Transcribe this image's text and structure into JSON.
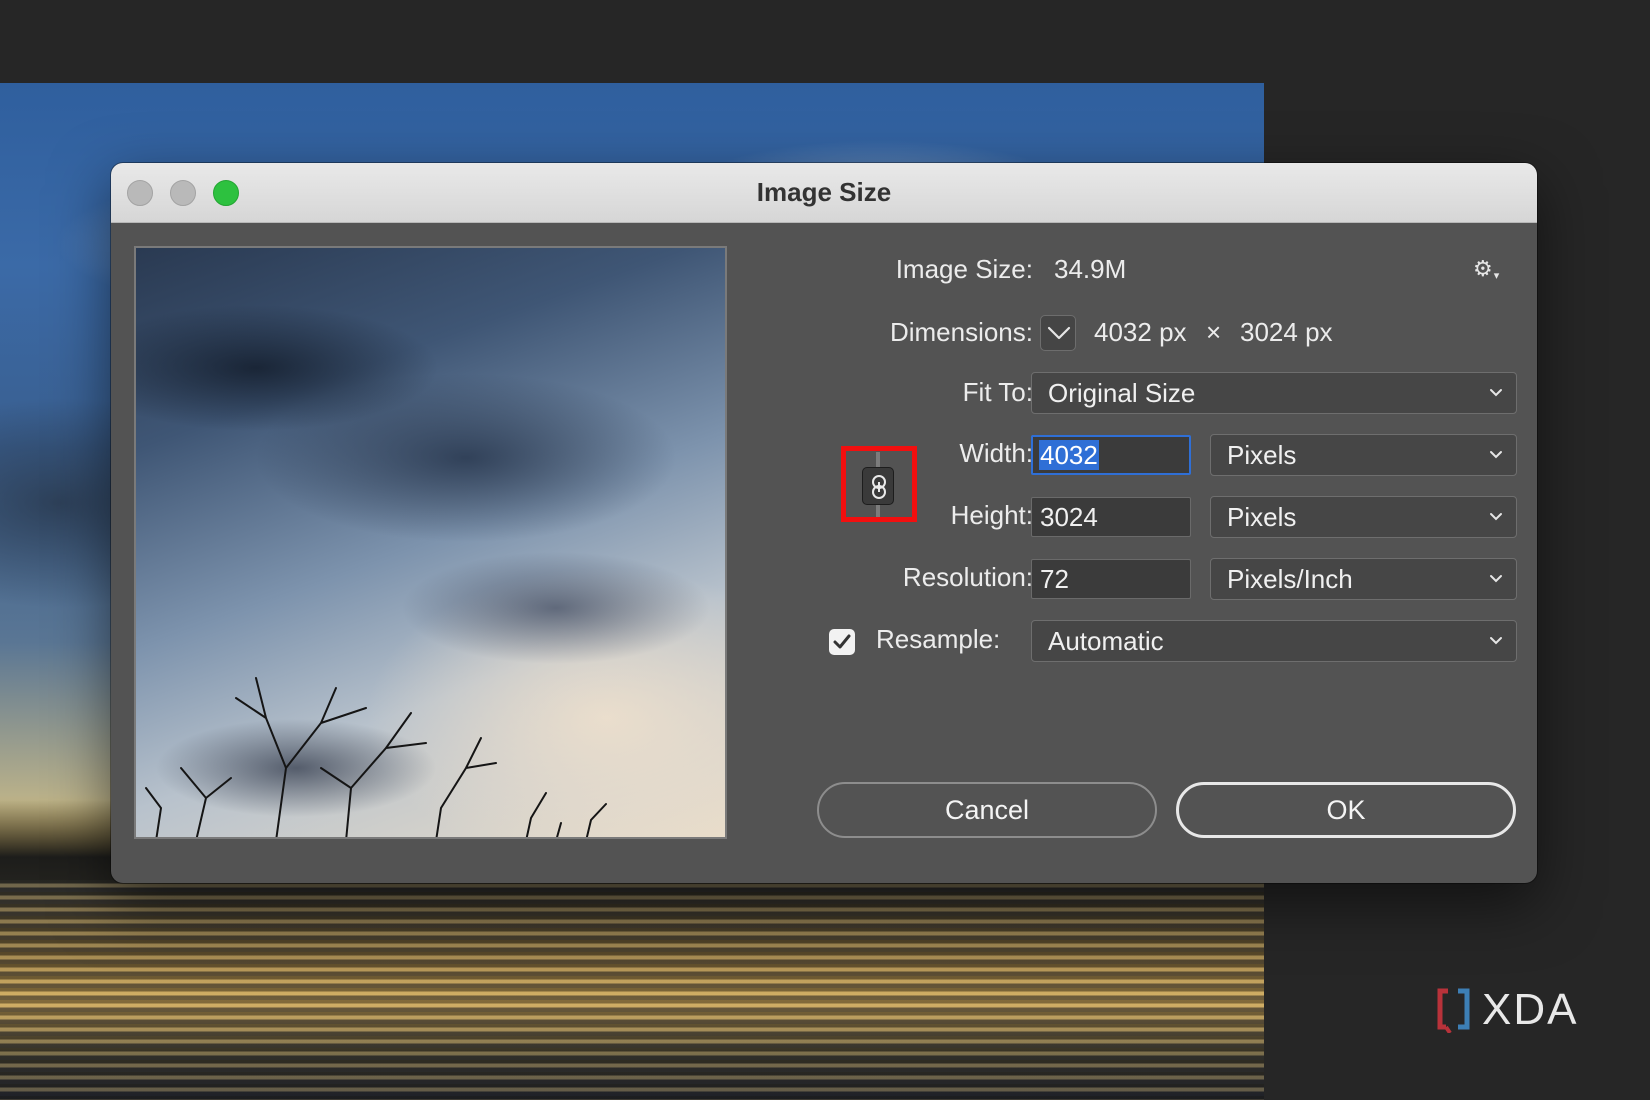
{
  "window": {
    "title": "Image Size"
  },
  "image_size": {
    "label": "Image Size:",
    "value": "34.9M"
  },
  "dimensions": {
    "label": "Dimensions:",
    "width": "4032 px",
    "separator": "×",
    "height": "3024 px"
  },
  "fit_to": {
    "label": "Fit To:",
    "value": "Original Size"
  },
  "width": {
    "label": "Width:",
    "value": "4032",
    "unit": "Pixels"
  },
  "height": {
    "label": "Height:",
    "value": "3024",
    "unit": "Pixels"
  },
  "resolution": {
    "label": "Resolution:",
    "value": "72",
    "unit": "Pixels/Inch"
  },
  "resample": {
    "label": "Resample:",
    "checked": true,
    "value": "Automatic"
  },
  "buttons": {
    "cancel": "Cancel",
    "ok": "OK"
  },
  "watermark": {
    "text": "XDA"
  },
  "colors": {
    "zoom_button": "#2dc13f",
    "focus_ring": "#2f6fd6",
    "highlight_box": "#f20f0f",
    "dialog_bg": "#535353"
  },
  "icons": [
    "gear-icon",
    "chevron-down-icon",
    "link-icon",
    "checkmark-icon"
  ]
}
